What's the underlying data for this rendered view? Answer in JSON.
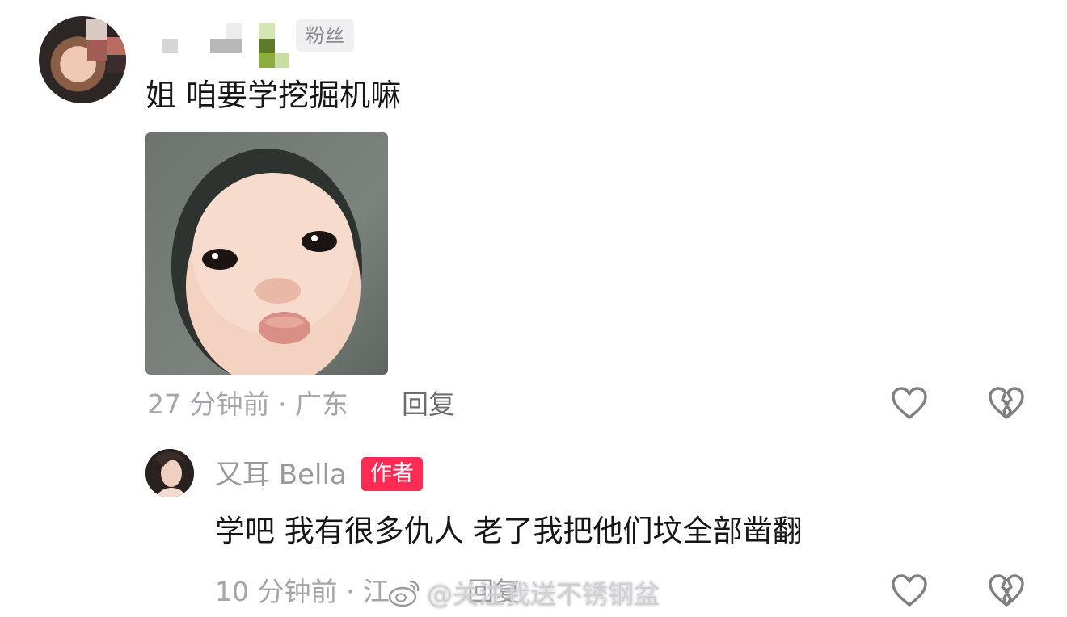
{
  "comment": {
    "badge": "粉丝",
    "text": "姐 咱要学挖掘机嘛",
    "time_location": "27 分钟前 · 广东",
    "reply_label": "回复"
  },
  "reply": {
    "username": "又耳 Bella",
    "badge": "作者",
    "text": "学吧 我有很多仇人 老了我把他们坟全部凿翻",
    "time_location": "10 分钟前 · 江",
    "reply_label": "回复"
  },
  "watermark": "@关注我送不锈钢盆",
  "icons": {
    "like": "heart-outline-icon",
    "dislike": "broken-heart-outline-icon",
    "weibo": "weibo-logo-icon"
  },
  "colors": {
    "author_badge": "#fe2c55",
    "fans_badge_bg": "#f0f0f2",
    "meta_text": "#a6a6aa"
  }
}
